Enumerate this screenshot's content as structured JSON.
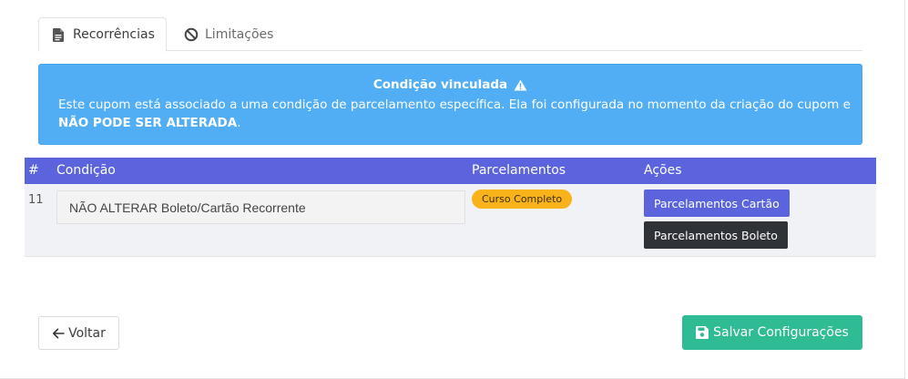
{
  "tabs": [
    {
      "label": "Recorrências",
      "icon": "document-icon",
      "active": true
    },
    {
      "label": "Limitações",
      "icon": "ban-icon",
      "active": false
    }
  ],
  "alert": {
    "title": "Condição vinculada",
    "icon": "warning-icon",
    "body_text": "Este cupom está associado a uma condição de parcelamento específica. Ela foi configurada no momento da criação do cupom e ",
    "body_strong": "NÃO PODE SER ALTERADA",
    "body_end": ".",
    "color": "#52aef4"
  },
  "table": {
    "headers": {
      "num": "#",
      "condition": "Condição",
      "installments": "Parcelamentos",
      "actions": "Ações"
    },
    "header_color": "#5b64dd",
    "rows": [
      {
        "num": "11",
        "condition": "NÃO ALTERAR Boleto/Cartão Recorrente",
        "badge": "Curso Completo",
        "badge_color": "#f8b31a",
        "actions": [
          "Parcelamentos Cartão",
          "Parcelamentos Boleto"
        ]
      }
    ]
  },
  "footer": {
    "back_label": "Voltar",
    "save_label": "Salvar Configurações",
    "save_color": "#2fbb94"
  }
}
